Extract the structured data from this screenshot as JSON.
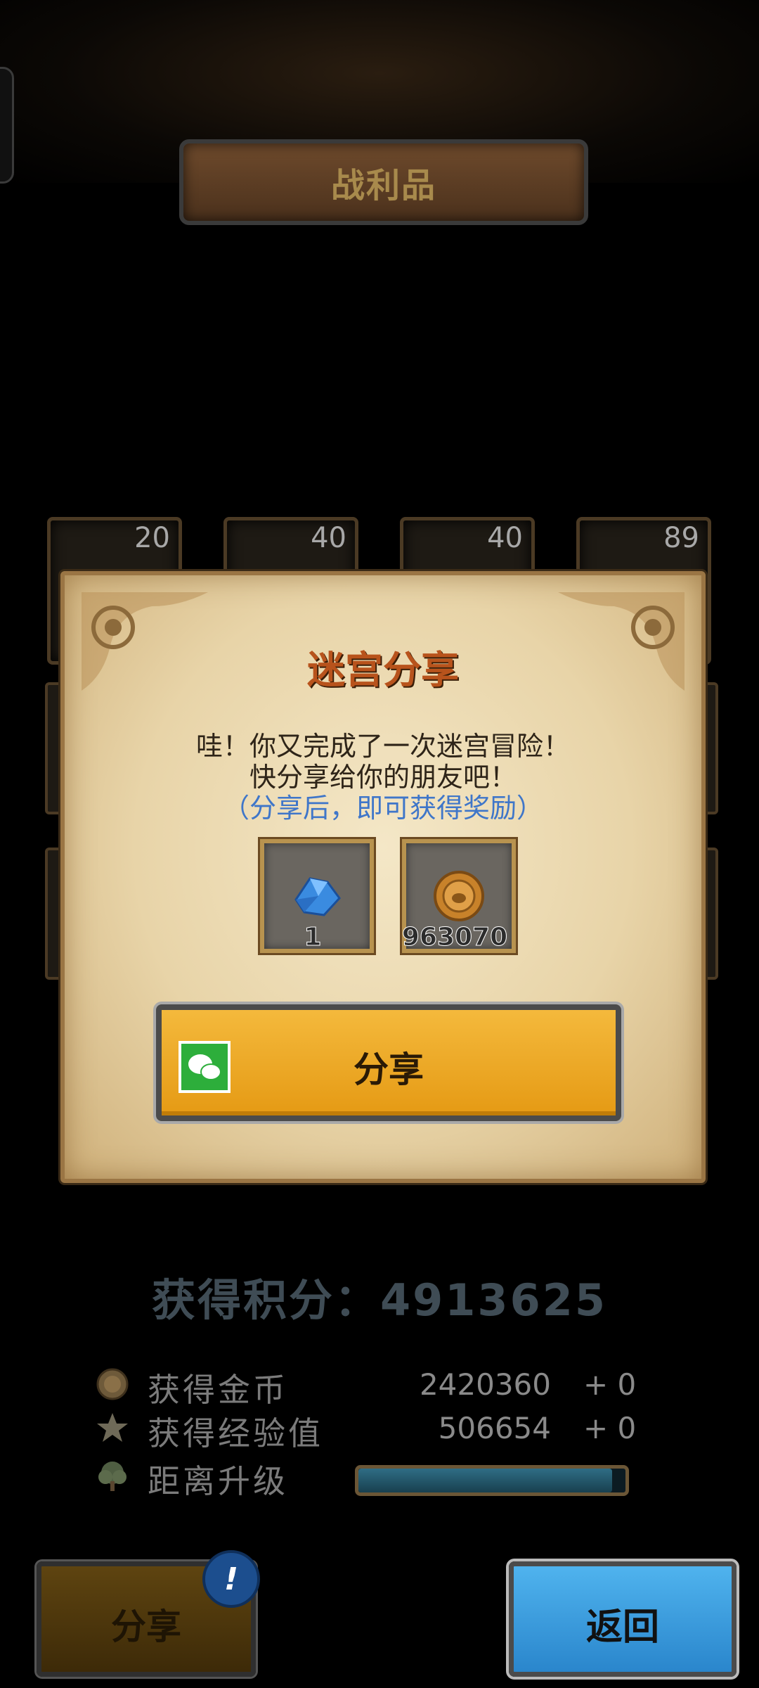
{
  "header": {
    "title": "战利品"
  },
  "loot_counts": [
    "20",
    "40",
    "40",
    "89"
  ],
  "dialog": {
    "title": "迷宫分享",
    "line1": "哇！你又完成了一次迷宫冒险！",
    "line2": "快分享给你的朋友吧！",
    "note": "（分享后，即可获得奖励）",
    "rewards": [
      {
        "icon": "blue-crystal-icon",
        "count": "1"
      },
      {
        "icon": "gold-coin-icon",
        "count": "963070"
      }
    ],
    "share_button": "分享"
  },
  "stats": {
    "score_label": "获得积分：",
    "score_value": "4913625",
    "gold_label": "获得金币",
    "gold_value": "2420360",
    "gold_add": "+ 0",
    "exp_label": "获得经验值",
    "exp_value": "506654",
    "exp_add": "+ 0",
    "level_label": "距离升级",
    "level_progress": 0.95
  },
  "footer": {
    "share_label": "分享",
    "badge_text": "!",
    "back_label": "返回"
  },
  "colors": {
    "dialog_title": "#b8531c",
    "note": "#3f76c9",
    "share_button": "#e59a14",
    "back_button": "#2a86cc"
  }
}
